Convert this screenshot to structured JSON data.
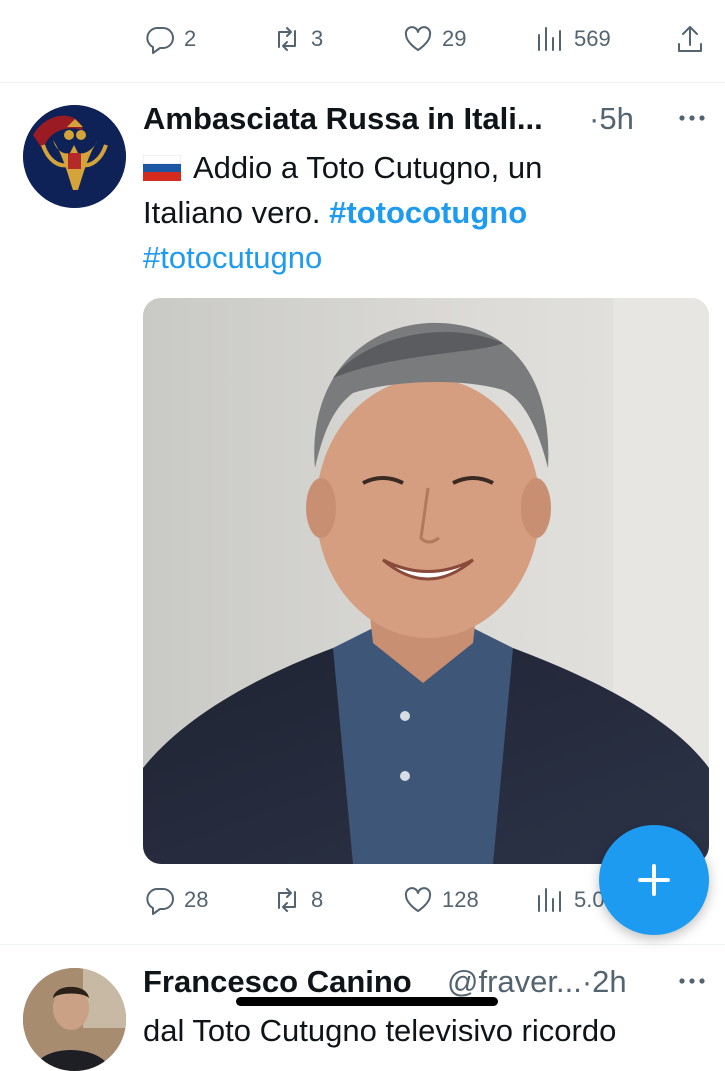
{
  "prev_tweet": {
    "actions": {
      "replies": "2",
      "retweets": "3",
      "likes": "29",
      "views": "569"
    }
  },
  "tweet": {
    "author_name": "Ambasciata Russa in Itali...",
    "separator": "·",
    "time": "5h",
    "text_line1": "Addio a Toto Cutugno, un",
    "text_line2": "Italiano vero.",
    "hashtag1": "#totocotugno",
    "hashtag2": "#totocutugno",
    "flag": "russia-flag",
    "actions": {
      "replies": "28",
      "retweets": "8",
      "likes": "128",
      "views": "5.0"
    }
  },
  "next_tweet": {
    "author_name": "Francesco Canino",
    "handle": "@fraver...",
    "separator": "·",
    "time": "2h",
    "text_partial": "dal Toto Cutugno televisivo ricordo"
  },
  "fab": {
    "icon": "plus-icon"
  },
  "colors": {
    "accent": "#1d9bf0",
    "muted": "#536471",
    "text": "#0f1419"
  }
}
